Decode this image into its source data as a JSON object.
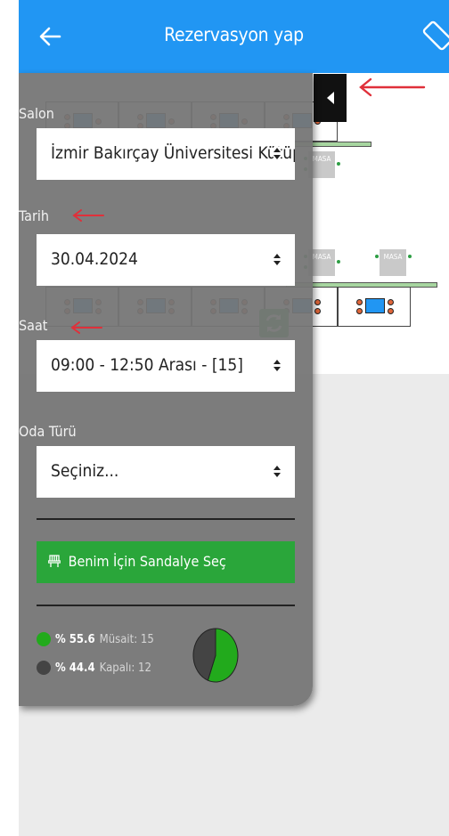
{
  "app": {
    "title": "Rezervasyon yap",
    "icons": {
      "back": "arrow-left-icon",
      "rotate": "screen-rotation-icon",
      "refresh": "refresh-icon",
      "chair": "chair-icon"
    },
    "colors": {
      "header": "#2196f3",
      "green": "#2aa63a",
      "panel": "#767676",
      "occupied": "#444444"
    }
  },
  "form": {
    "salon": {
      "label": "Salon",
      "value": "İzmir Bakırçay Üniversitesi Kütüphanesi"
    },
    "tarih": {
      "label": "Tarih",
      "value": "30.04.2024"
    },
    "saat": {
      "label": "Saat",
      "value": "09:00 - 12:50 Arası - [15]"
    },
    "oda_turu": {
      "label": "Oda Türü",
      "value": "Seçiniz..."
    },
    "button_label": "Benim İçin Sandalye Seç"
  },
  "availability": {
    "musait": {
      "percent": "% 55.6",
      "label": "Müsait: 15"
    },
    "kapali": {
      "percent": "% 44.4",
      "label": "Kapalı: 12"
    }
  },
  "map": {
    "gray_desks": [
      "MASA",
      "MASA",
      "MASA"
    ]
  },
  "chart_data": {
    "type": "pie",
    "categories": [
      "Müsait",
      "Kapalı"
    ],
    "values": [
      55.6,
      44.4
    ],
    "colors": [
      "#22aa1c",
      "#444444"
    ]
  }
}
